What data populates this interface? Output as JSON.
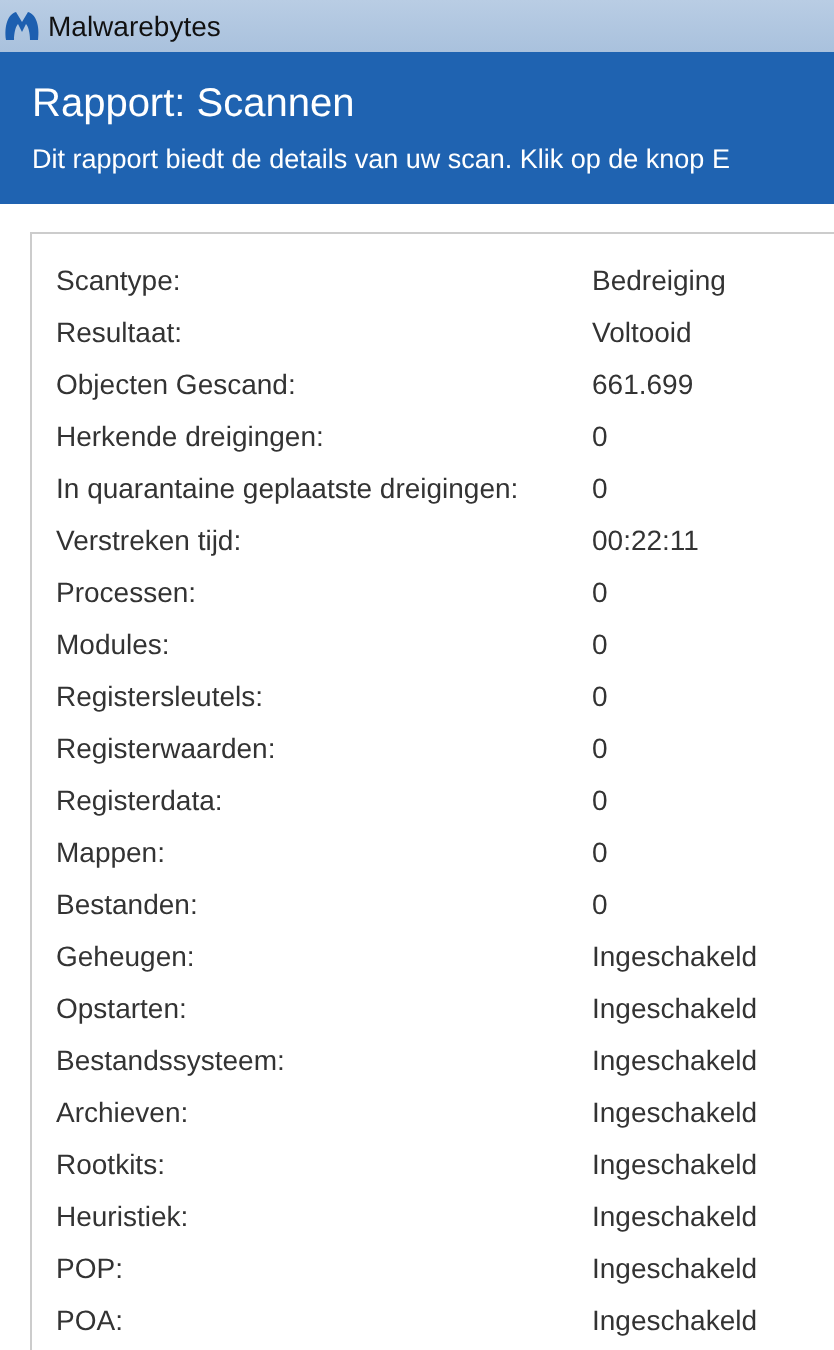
{
  "window": {
    "title": "Malwarebytes"
  },
  "header": {
    "title": "Rapport: Scannen",
    "subtitle": "Dit rapport biedt de details van uw scan. Klik op de knop E"
  },
  "details": [
    {
      "label": "Scantype:",
      "value": "Bedreiging"
    },
    {
      "label": "Resultaat:",
      "value": "Voltooid"
    },
    {
      "label": "Objecten Gescand:",
      "value": "661.699"
    },
    {
      "label": "Herkende dreigingen:",
      "value": "0"
    },
    {
      "label": "In quarantaine geplaatste dreigingen:",
      "value": "0"
    },
    {
      "label": "Verstreken tijd:",
      "value": "00:22:11"
    },
    {
      "label": "Processen:",
      "value": "0"
    },
    {
      "label": "Modules:",
      "value": "0"
    },
    {
      "label": "Registersleutels:",
      "value": "0"
    },
    {
      "label": "Registerwaarden:",
      "value": "0"
    },
    {
      "label": "Registerdata:",
      "value": "0"
    },
    {
      "label": "Mappen:",
      "value": "0"
    },
    {
      "label": "Bestanden:",
      "value": "0"
    },
    {
      "label": "Geheugen:",
      "value": "Ingeschakeld"
    },
    {
      "label": "Opstarten:",
      "value": "Ingeschakeld"
    },
    {
      "label": "Bestandssysteem:",
      "value": "Ingeschakeld"
    },
    {
      "label": "Archieven:",
      "value": "Ingeschakeld"
    },
    {
      "label": "Rootkits:",
      "value": "Ingeschakeld"
    },
    {
      "label": "Heuristiek:",
      "value": "Ingeschakeld"
    },
    {
      "label": "POP:",
      "value": "Ingeschakeld"
    },
    {
      "label": "POA:",
      "value": "Ingeschakeld"
    }
  ]
}
